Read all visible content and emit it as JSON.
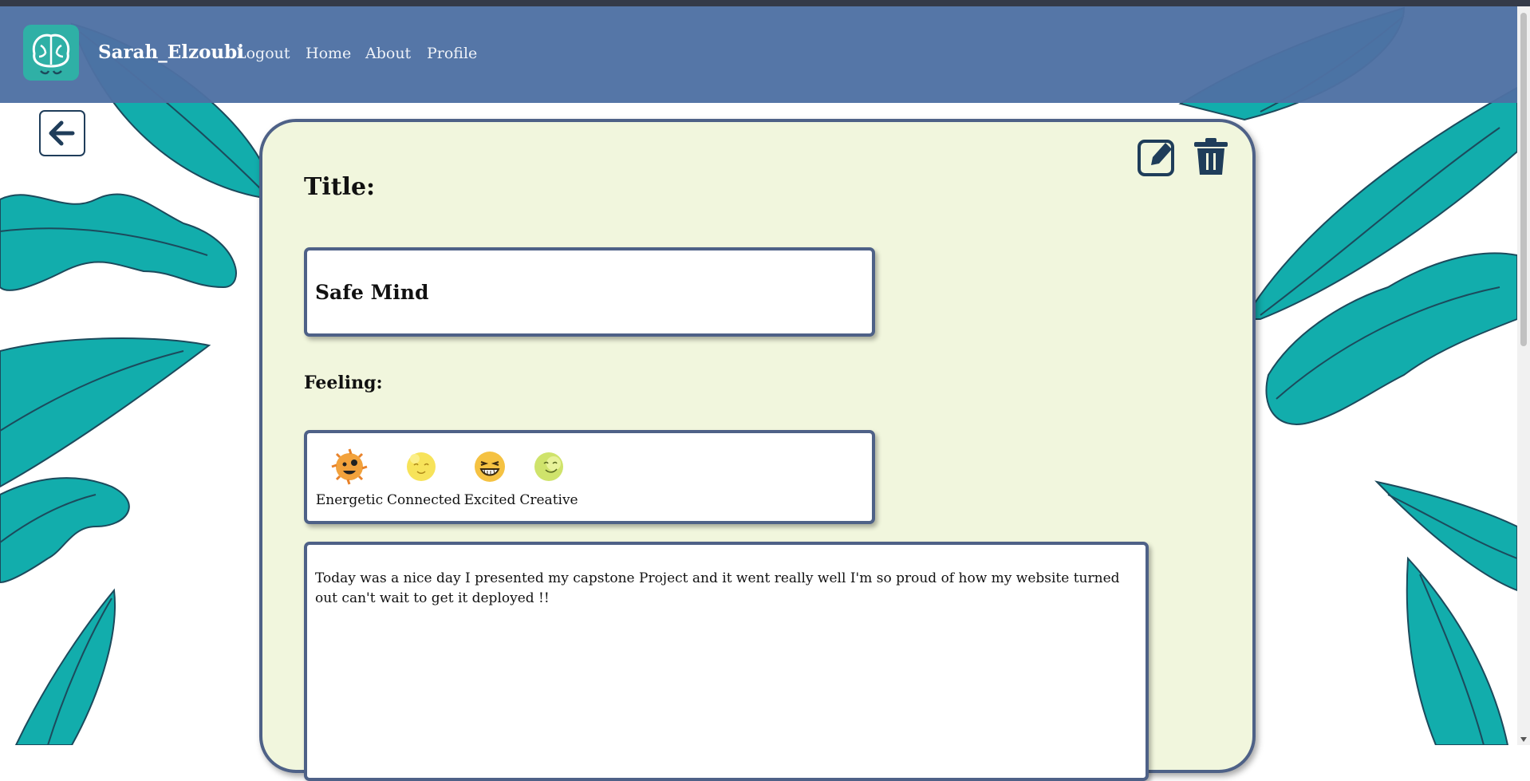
{
  "navbar": {
    "brand": "Sarah_Elzoubi",
    "links": [
      "Logout",
      "Home",
      "About",
      "Profile"
    ],
    "logo_icon": "brain-icon"
  },
  "back_button": {
    "icon": "arrow-left-icon"
  },
  "actions": {
    "edit_icon": "edit-icon",
    "delete_icon": "trash-icon"
  },
  "entry": {
    "title_label": "Title:",
    "title_value": "Safe Mind",
    "feeling_label": "Feeling:",
    "feelings": [
      {
        "label": "Energetic",
        "icon": "energetic-face-icon",
        "color": "#f2a23c"
      },
      {
        "label": "Connected",
        "icon": "connected-face-icon",
        "color": "#f7e35a"
      },
      {
        "label": "Excited",
        "icon": "excited-face-icon",
        "color": "#f5c242"
      },
      {
        "label": "Creative",
        "icon": "creative-face-icon",
        "color": "#cfe36b"
      }
    ],
    "text": "Today was a nice day I presented my capstone Project and it went really well I'm so proud of how my website turned out can't wait to get it deployed !!"
  },
  "colors": {
    "navbar": "#4e70a3",
    "card_bg": "#f1f6dd",
    "border": "#4e6187",
    "leaf": "#12adac",
    "icon_dark": "#1f3d5a"
  }
}
